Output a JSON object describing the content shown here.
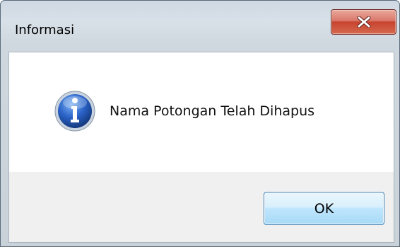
{
  "dialog": {
    "title": "Informasi",
    "close_icon": "close-x-icon",
    "message_icon": "information-icon",
    "message": "Nama Potongan Telah Dihapus",
    "ok_label": "OK"
  },
  "colors": {
    "close_button": "#c7442f",
    "ok_button_border": "#3c7fb1",
    "info_icon_blue": "#1f56b7"
  }
}
